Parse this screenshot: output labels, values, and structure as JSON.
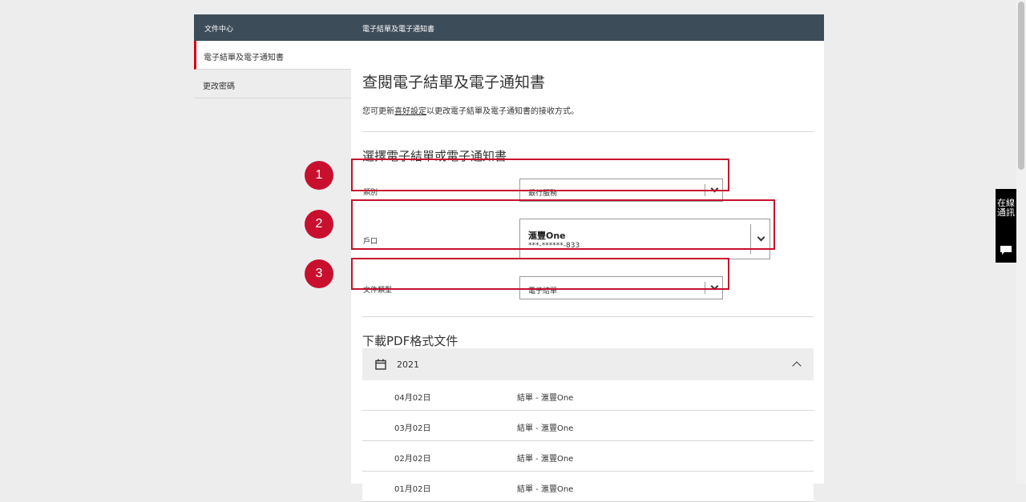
{
  "sidebar": {
    "header": "文件中心",
    "items": [
      {
        "label": "電子結單及電子通知書",
        "active": true
      },
      {
        "label": "更改密碼",
        "active": false
      }
    ]
  },
  "main": {
    "header": "電子結單及電子通知書",
    "title": "查閱電子結單及電子通知書",
    "intro": {
      "before": "您可更新",
      "link": "喜好設定",
      "after": "以更改電子結單及電子通知書的接收方式。"
    },
    "select_section": {
      "title": "選擇電子結單或電子通知書",
      "fields": [
        {
          "step": "1",
          "label": "類別",
          "value": "銀行服務"
        },
        {
          "step": "2",
          "label": "戶口",
          "account_name": "滙豐One",
          "account_number": "***-******-833"
        },
        {
          "step": "3",
          "label": "文件類型",
          "value": "電子結單"
        }
      ]
    },
    "download_section": {
      "title": "下載PDF格式文件",
      "year": "2021",
      "rows": [
        {
          "date": "04月02日",
          "desc": "結單 - 滙豐One"
        },
        {
          "date": "03月02日",
          "desc": "結單 - 滙豐One"
        },
        {
          "date": "02月02日",
          "desc": "結單 - 滙豐One"
        },
        {
          "date": "01月02日",
          "desc": "結單 - 滙豐One"
        }
      ]
    }
  },
  "chat": {
    "label": "在線通訊"
  },
  "colors": {
    "header_bg": "#3d4c59",
    "accent_red": "#db0011",
    "annotation_red": "#c8102e",
    "sidebar_bg": "#ededed"
  }
}
